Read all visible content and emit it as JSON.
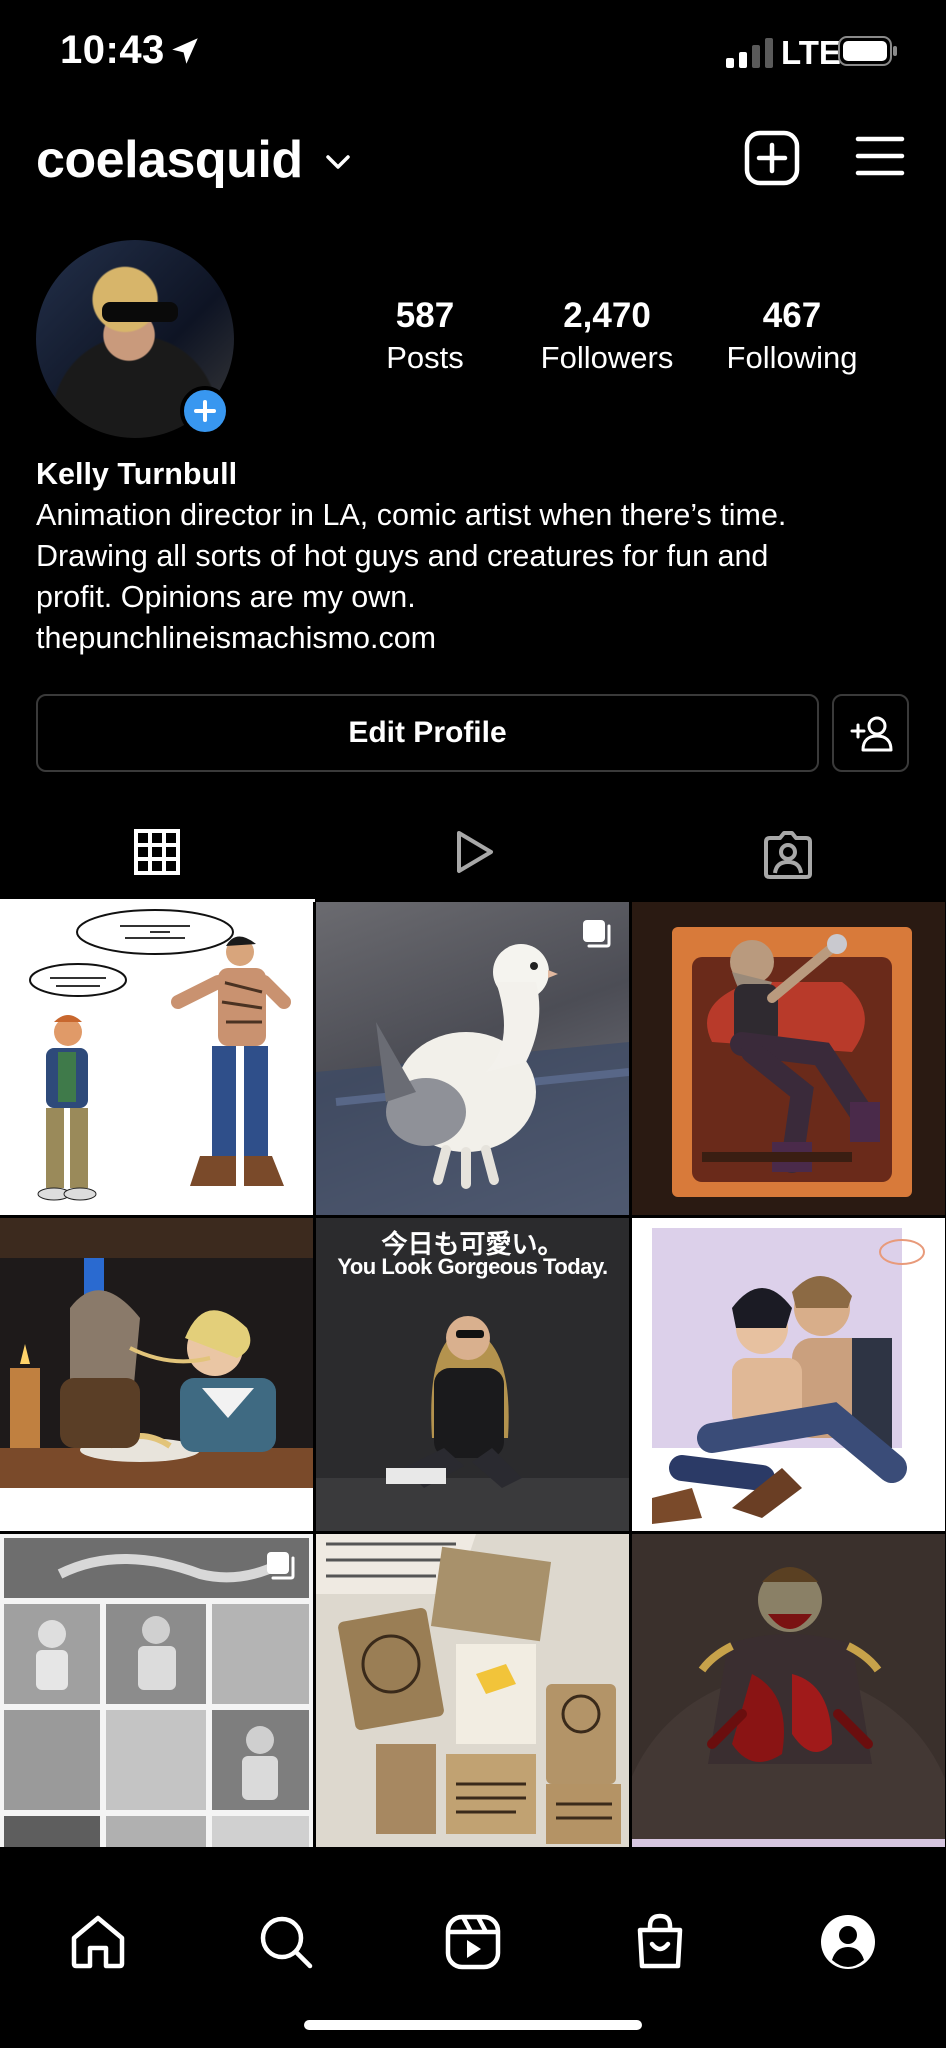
{
  "status_bar": {
    "time": "10:43",
    "network": "LTE",
    "icons": [
      "location-arrow-icon",
      "signal-bars-icon",
      "battery-icon"
    ]
  },
  "header": {
    "username": "coelasquid",
    "icons": [
      "chevron-down-icon",
      "new-post-icon",
      "menu-icon"
    ]
  },
  "profile": {
    "stats": [
      {
        "value": "587",
        "label": "Posts"
      },
      {
        "value": "2,470",
        "label": "Followers"
      },
      {
        "value": "467",
        "label": "Following"
      }
    ],
    "name": "Kelly Turnbull",
    "bio_lines": [
      "Animation director in LA, comic artist when there’s time.",
      "Drawing all sorts of hot guys and creatures for fun and",
      "profit. Opinions are my own."
    ],
    "link": "thepunchlineismachismo.com"
  },
  "buttons": {
    "edit_profile": "Edit Profile"
  },
  "tabs": [
    {
      "name": "grid",
      "icon": "grid-icon",
      "active": true
    },
    {
      "name": "reels",
      "icon": "play-icon",
      "active": false
    },
    {
      "name": "tagged",
      "icon": "tagged-person-icon",
      "active": false
    }
  ],
  "posts": [
    {
      "id": "post-1",
      "kind": "comic",
      "multi": false
    },
    {
      "id": "post-2",
      "kind": "photo",
      "multi": true
    },
    {
      "id": "post-3",
      "kind": "illustration",
      "multi": false
    },
    {
      "id": "post-4",
      "kind": "illustration",
      "multi": false
    },
    {
      "id": "post-5",
      "kind": "photo",
      "multi": false,
      "caption_line1": "今日も可愛い。",
      "caption_line2": "You Look Gorgeous Today."
    },
    {
      "id": "post-6",
      "kind": "illustration",
      "multi": false
    },
    {
      "id": "post-7",
      "kind": "comic",
      "multi": true
    },
    {
      "id": "post-8",
      "kind": "photo",
      "multi": false
    },
    {
      "id": "post-9",
      "kind": "illustration",
      "multi": false
    }
  ],
  "bottom_nav": [
    "home-icon",
    "search-icon",
    "reels-icon",
    "shop-icon",
    "profile-icon"
  ],
  "colors": {
    "background": "#000000",
    "accent_blue": "#3897f0",
    "border": "#3a3a3a"
  }
}
